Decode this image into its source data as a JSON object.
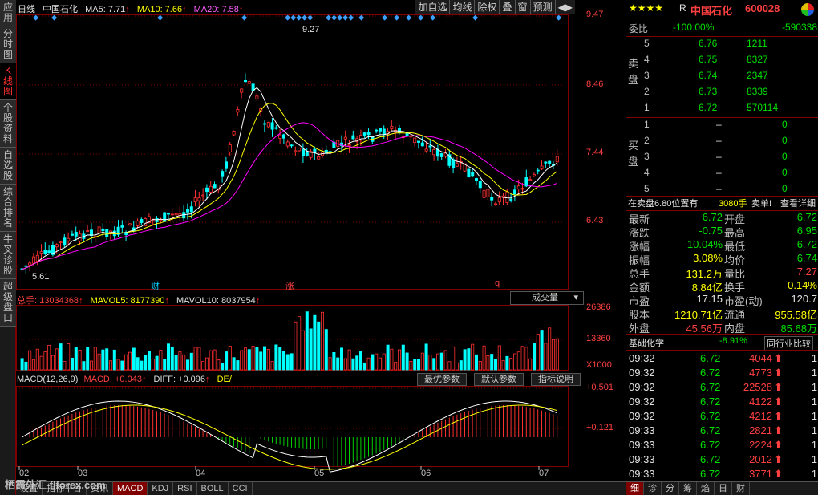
{
  "left_tabs": [
    "应用",
    "分时图",
    "K线图",
    "个股资料",
    "自选股",
    "综合排名",
    "牛叉诊股",
    "超级盘口"
  ],
  "header": {
    "period": "日线",
    "stock_name": "中国石化",
    "ma5": "MA5: 7.71",
    "ma10": "MA10: 7.66",
    "ma20": "MA20: 7.58"
  },
  "toolbar": [
    "加自选",
    "均线",
    "除权",
    "叠",
    "窗",
    "预测",
    "◀▶"
  ],
  "price_axis": [
    "9.47",
    "8.46",
    "7.44",
    "6.43"
  ],
  "annotations": {
    "high": "9.27",
    "low": "5.61",
    "marker_cai": "财",
    "marker_zhang": "涨",
    "marker_q": "q"
  },
  "volume": {
    "total": "总手: 13034368",
    "mavol5": "MAVOL5: 8177390",
    "mavol10": "MAVOL10: 8037954",
    "mode": "成交量",
    "axis": [
      "26386",
      "13360",
      "X1000"
    ]
  },
  "macd": {
    "label": "MACD(12,26,9)",
    "macd": "MACD: +0.043",
    "diff": "DIFF: +0.096",
    "dea": "DE/",
    "buttons": [
      "最优参数",
      "默认参数",
      "指标说明"
    ],
    "axis": [
      "+0.501",
      "+0.121"
    ]
  },
  "x_axis": [
    "02",
    "03",
    "04",
    "05",
    "06",
    "07"
  ],
  "bottom_tabs": [
    "设置",
    "指标平台",
    "资讯",
    "MACD",
    "KDJ",
    "RSI",
    "BOLL",
    "CCI"
  ],
  "watermark": "栖霞外汇 flforex.com",
  "quote": {
    "stars": "★★★★",
    "r": "R",
    "name": "中国石化",
    "code": "600028",
    "wei_bi_label": "委比",
    "wei_bi": "-100.00%",
    "wei_cha": "-590338",
    "sell_label": "卖盘",
    "buy_label": "买盘",
    "sell": [
      {
        "level": "5",
        "price": "6.76",
        "vol": "1211"
      },
      {
        "level": "4",
        "price": "6.75",
        "vol": "8327"
      },
      {
        "level": "3",
        "price": "6.74",
        "vol": "2347"
      },
      {
        "level": "2",
        "price": "6.73",
        "vol": "8339"
      },
      {
        "level": "1",
        "price": "6.72",
        "vol": "570114"
      }
    ],
    "buy": [
      {
        "level": "1",
        "price": "–",
        "vol": "0"
      },
      {
        "level": "2",
        "price": "–",
        "vol": "0"
      },
      {
        "level": "3",
        "price": "–",
        "vol": "0"
      },
      {
        "level": "4",
        "price": "–",
        "vol": "0"
      },
      {
        "level": "5",
        "price": "–",
        "vol": "0"
      }
    ],
    "ask_line": {
      "text": "在卖盘6.80位置有",
      "qty": "3080手",
      "tag": "卖单!",
      "detail": "查看详细"
    },
    "stats": [
      {
        "l1": "最新",
        "v1": "6.72",
        "l2": "开盘",
        "v2": "6.72"
      },
      {
        "l1": "涨跌",
        "v1": "-0.75",
        "l2": "最高",
        "v2": "6.95"
      },
      {
        "l1": "涨幅",
        "v1": "-10.04%",
        "l2": "最低",
        "v2": "6.72"
      },
      {
        "l1": "振幅",
        "v1": "3.08%",
        "l2": "均价",
        "v2": "6.74"
      },
      {
        "l1": "总手",
        "v1": "131.2万",
        "l2": "量比",
        "v2": "7.27"
      },
      {
        "l1": "金额",
        "v1": "8.84亿",
        "l2": "换手",
        "v2": "0.14%"
      },
      {
        "l1": "市盈",
        "v1": "17.15",
        "l2": "市盈(动)",
        "v2": "120.7"
      },
      {
        "l1": "股本",
        "v1": "1210.71亿",
        "l2": "流通",
        "v2": "955.58亿"
      },
      {
        "l1": "外盘",
        "v1": "45.56万",
        "l2": "内盘",
        "v2": "85.68万"
      }
    ],
    "sector": {
      "name": "基础化学",
      "change": "-8.91%",
      "compare": "同行业比较"
    },
    "ticks": [
      {
        "time": "09:32",
        "price": "6.72",
        "vol": "4044",
        "n": "1"
      },
      {
        "time": "09:32",
        "price": "6.72",
        "vol": "4773",
        "n": "1"
      },
      {
        "time": "09:32",
        "price": "6.72",
        "vol": "22528",
        "n": "1"
      },
      {
        "time": "09:32",
        "price": "6.72",
        "vol": "4122",
        "n": "1"
      },
      {
        "time": "09:32",
        "price": "6.72",
        "vol": "4212",
        "n": "1"
      },
      {
        "time": "09:33",
        "price": "6.72",
        "vol": "2821",
        "n": "1"
      },
      {
        "time": "09:33",
        "price": "6.72",
        "vol": "2224",
        "n": "1"
      },
      {
        "time": "09:33",
        "price": "6.72",
        "vol": "2012",
        "n": "1"
      },
      {
        "time": "09:33",
        "price": "6.72",
        "vol": "3771",
        "n": "1"
      }
    ],
    "tabs": [
      "细",
      "诊",
      "分",
      "筹",
      "焰",
      "日",
      "财"
    ]
  },
  "colors": {
    "up": "#ff3030",
    "down": "#00ffff",
    "ma5": "#ffffff",
    "ma10": "#ffff00",
    "ma20": "#ff00ff",
    "grid": "#800000"
  }
}
